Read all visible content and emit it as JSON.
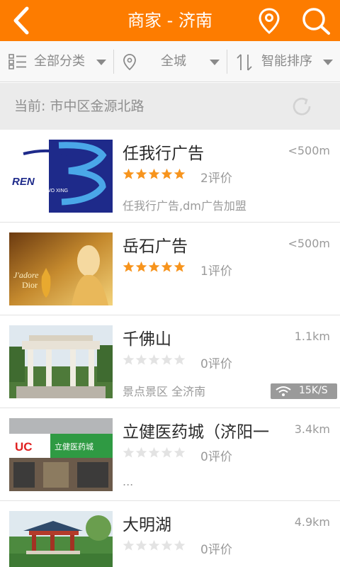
{
  "header": {
    "title": "商家 - 济南",
    "back_icon": "back-arrow-icon",
    "location_icon": "location-pin-icon",
    "search_icon": "search-icon",
    "color": "#fd7c00"
  },
  "filters": [
    {
      "label": "全部分类",
      "icon": "list-icon"
    },
    {
      "label": "全城",
      "icon": "location-pin-icon"
    },
    {
      "label": "智能排序",
      "icon": "sort-icon"
    }
  ],
  "current": {
    "text": "当前: 市中区金源北路",
    "icon": "refresh-icon"
  },
  "merchants": [
    {
      "name": "任我行广告",
      "distance": "<500m",
      "rating": 5,
      "reviews": "2评价",
      "desc": "任我行广告,dm广告加盟",
      "thumb_text": "REN WO XING"
    },
    {
      "name": "岳石广告",
      "distance": "<500m",
      "rating": 5,
      "reviews": "1评价",
      "desc": "",
      "thumb_text": "J'adore Dior"
    },
    {
      "name": "千佛山",
      "distance": "1.1km",
      "rating": 0,
      "reviews": "0评价",
      "desc": "景点景区 全济南",
      "badge": "15K/S"
    },
    {
      "name": "立健医药城（济阳一",
      "distance": "3.4km",
      "rating": 0,
      "reviews": "0评价",
      "desc": "...",
      "thumb_text": "UC 立健医药城"
    },
    {
      "name": "大明湖",
      "distance": "4.9km",
      "rating": 0,
      "reviews": "0评价",
      "desc": ""
    }
  ],
  "colors": {
    "star_on": "#f7941d",
    "star_off": "#e3e3e3"
  }
}
